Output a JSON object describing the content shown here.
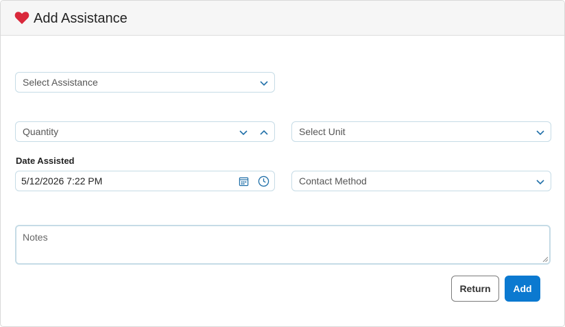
{
  "header": {
    "title": "Add Assistance",
    "icon": "heart-icon",
    "icon_color": "#d9283b"
  },
  "form": {
    "assistance_placeholder": "Select Assistance",
    "quantity_placeholder": "Quantity",
    "unit_placeholder": "Select Unit",
    "date_label": "Date Assisted",
    "date_value": "5/12/2026 7:22 PM",
    "contact_placeholder": "Contact Method",
    "notes_placeholder": "Notes"
  },
  "actions": {
    "return_label": "Return",
    "add_label": "Add"
  },
  "colors": {
    "accent": "#0b79d0",
    "border": "#c5dbe6",
    "icon": "#1f6fa8"
  }
}
